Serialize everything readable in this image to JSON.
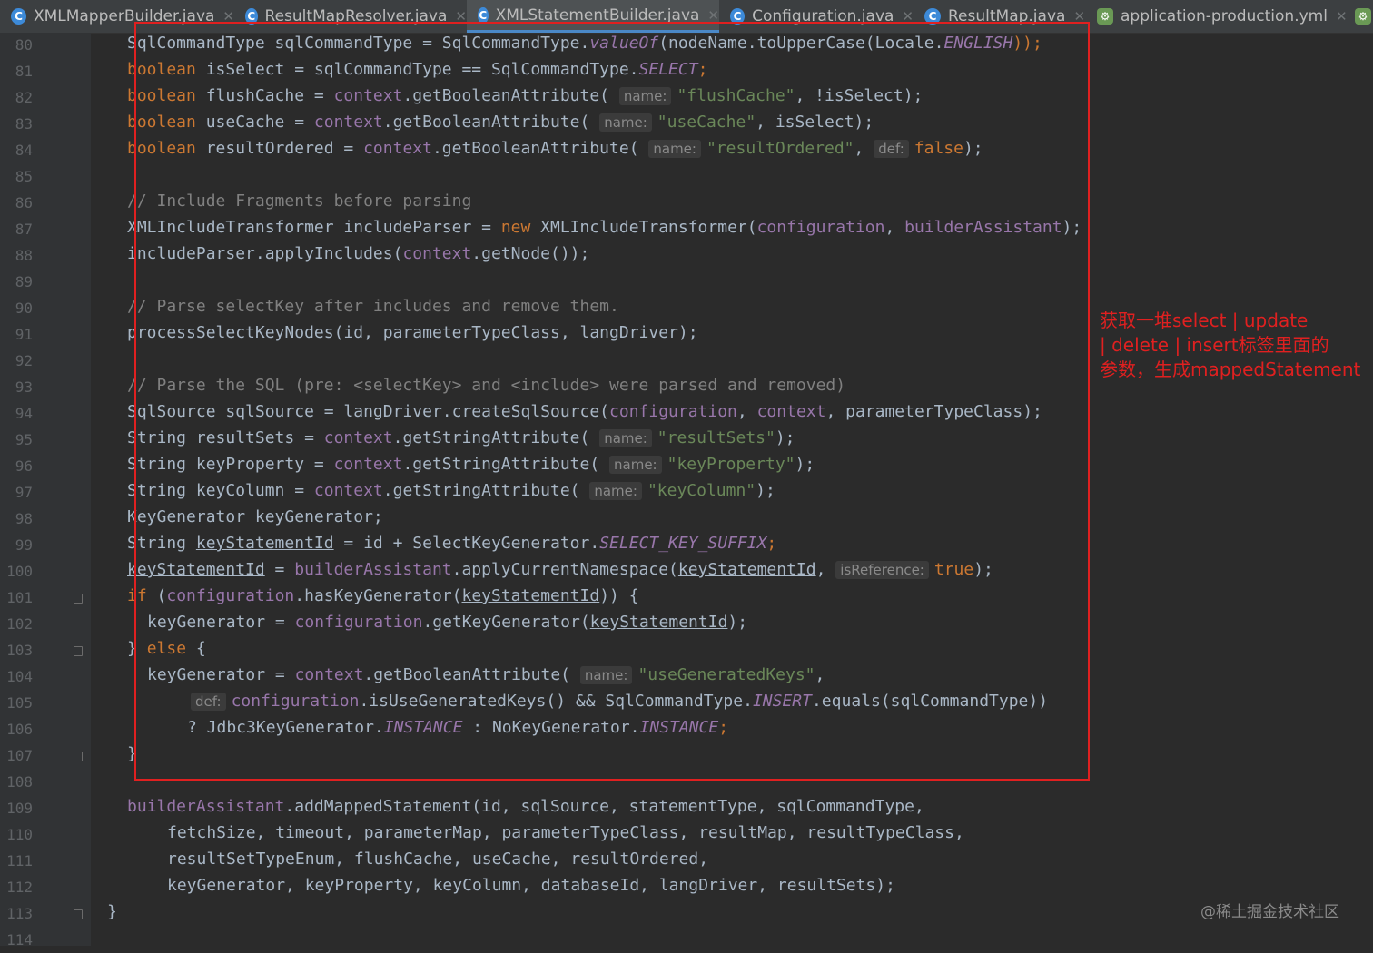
{
  "tabs": [
    {
      "label": "XMLMapperBuilder.java",
      "icon": "java-class-icon",
      "active": false
    },
    {
      "label": "ResultMapResolver.java",
      "icon": "java-class-icon",
      "active": false
    },
    {
      "label": "XMLStatementBuilder.java",
      "icon": "java-class-icon",
      "active": true
    },
    {
      "label": "Configuration.java",
      "icon": "java-class-icon",
      "active": false
    },
    {
      "label": "ResultMap.java",
      "icon": "java-class-icon",
      "active": false
    },
    {
      "label": "application-production.yml",
      "icon": "yaml-file-icon",
      "active": false
    }
  ],
  "line_numbers": [
    "80",
    "81",
    "82",
    "83",
    "84",
    "85",
    "86",
    "87",
    "88",
    "89",
    "90",
    "91",
    "92",
    "93",
    "94",
    "95",
    "96",
    "97",
    "98",
    "99",
    "100",
    "101",
    "102",
    "103",
    "104",
    "105",
    "106",
    "107",
    "108",
    "109",
    "110",
    "111",
    "112",
    "113",
    "114"
  ],
  "code": {
    "l80": {
      "a": "SqlCommandType sqlCommandType = SqlCommandType.",
      "b": "valueOf",
      "c": "(nodeName.toUpperCase(Locale.",
      "d": "ENGLISH",
      "e": "));"
    },
    "l81": {
      "kw": "boolean",
      "a": " isSelect = sqlCommandType == SqlCommandType.",
      "st": "SELECT",
      "e": ";"
    },
    "l82": {
      "kw": "boolean",
      "a": " flushCache = ",
      "fld": "context",
      "b": ".getBooleanAttribute( ",
      "hint": "name:",
      "str": "\"flushCache\"",
      "c": ", !isSelect);"
    },
    "l83": {
      "kw": "boolean",
      "a": " useCache = ",
      "fld": "context",
      "b": ".getBooleanAttribute( ",
      "hint": "name:",
      "str": "\"useCache\"",
      "c": ", isSelect);"
    },
    "l84": {
      "kw": "boolean",
      "a": " resultOrdered = ",
      "fld": "context",
      "b": ".getBooleanAttribute( ",
      "hint": "name:",
      "str": "\"resultOrdered\"",
      "c": ", ",
      "hint2": "def:",
      "kw2": "false",
      "e": ");"
    },
    "l86": "// Include Fragments before parsing",
    "l87": {
      "a": "XMLIncludeTransformer includeParser = ",
      "kw": "new",
      "b": " XMLIncludeTransformer(",
      "fld": "configuration",
      "c": ", ",
      "fld2": "builderAssistant",
      "e": ");"
    },
    "l88": {
      "a": "includeParser.applyIncludes(",
      "fld": "context",
      "e": ".getNode());"
    },
    "l90": "// Parse selectKey after includes and remove them.",
    "l91": "processSelectKeyNodes(id, parameterTypeClass, langDriver);",
    "l93": "// Parse the SQL (pre: <selectKey> and <include> were parsed and removed)",
    "l94": {
      "a": "SqlSource sqlSource = langDriver.createSqlSource(",
      "fld": "configuration",
      "b": ", ",
      "fld2": "context",
      "e": ", parameterTypeClass);"
    },
    "l95": {
      "a": "String resultSets = ",
      "fld": "context",
      "b": ".getStringAttribute( ",
      "hint": "name:",
      "str": "\"resultSets\"",
      "e": ");"
    },
    "l96": {
      "a": "String keyProperty = ",
      "fld": "context",
      "b": ".getStringAttribute( ",
      "hint": "name:",
      "str": "\"keyProperty\"",
      "e": ");"
    },
    "l97": {
      "a": "String keyColumn = ",
      "fld": "context",
      "b": ".getStringAttribute( ",
      "hint": "name:",
      "str": "\"keyColumn\"",
      "e": ");"
    },
    "l98": "KeyGenerator keyGenerator;",
    "l99": {
      "a": "String ",
      "ul": "keyStatementId",
      "b": " = id + SelectKeyGenerator.",
      "st": "SELECT_KEY_SUFFIX",
      "e": ";"
    },
    "l100": {
      "ul": "keyStatementId",
      "a": " = ",
      "fld": "builderAssistant",
      "b": ".applyCurrentNamespace(",
      "ul2": "keyStatementId",
      "c": ", ",
      "hint": "isReference:",
      "kw": "true",
      "e": ");"
    },
    "l101": {
      "kw": "if",
      "a": " (",
      "fld": "configuration",
      "b": ".hasKeyGenerator(",
      "ul": "keyStatementId",
      "e": ")) {"
    },
    "l102": {
      "a": "keyGenerator = ",
      "fld": "configuration",
      "b": ".getKeyGenerator(",
      "ul": "keyStatementId",
      "e": ");"
    },
    "l103": {
      "a": "} ",
      "kw": "else",
      "e": " {"
    },
    "l104": {
      "a": "keyGenerator = ",
      "fld": "context",
      "b": ".getBooleanAttribute( ",
      "hint": "name:",
      "str": "\"useGeneratedKeys\"",
      "e": ","
    },
    "l105": {
      "hint": "def:",
      "fld": "configuration",
      "a": ".isUseGeneratedKeys() && SqlCommandType.",
      "st": "INSERT",
      "e": ".equals(sqlCommandType))"
    },
    "l106": {
      "a": "? Jdbc3KeyGenerator.",
      "st": "INSTANCE",
      "b": " : NoKeyGenerator.",
      "st2": "INSTANCE",
      "e": ";"
    },
    "l107": "}",
    "l109": {
      "fld": "builderAssistant",
      "a": ".addMappedStatement(id, sqlSource, statementType, sqlCommandType,"
    },
    "l110": "fetchSize, timeout, parameterMap, parameterTypeClass, resultMap, resultTypeClass,",
    "l111": "resultSetTypeEnum, flushCache, useCache, resultOrdered,",
    "l112": "keyGenerator, keyProperty, keyColumn, databaseId, langDriver, resultSets);",
    "l113": "}"
  },
  "annotation": {
    "lines": [
      "获取一堆select | update",
      "| delete | insert标签里面的",
      "参数，生成mappedStatement"
    ],
    "color": "#e02020"
  },
  "watermark": "@稀土掘金技术社区"
}
